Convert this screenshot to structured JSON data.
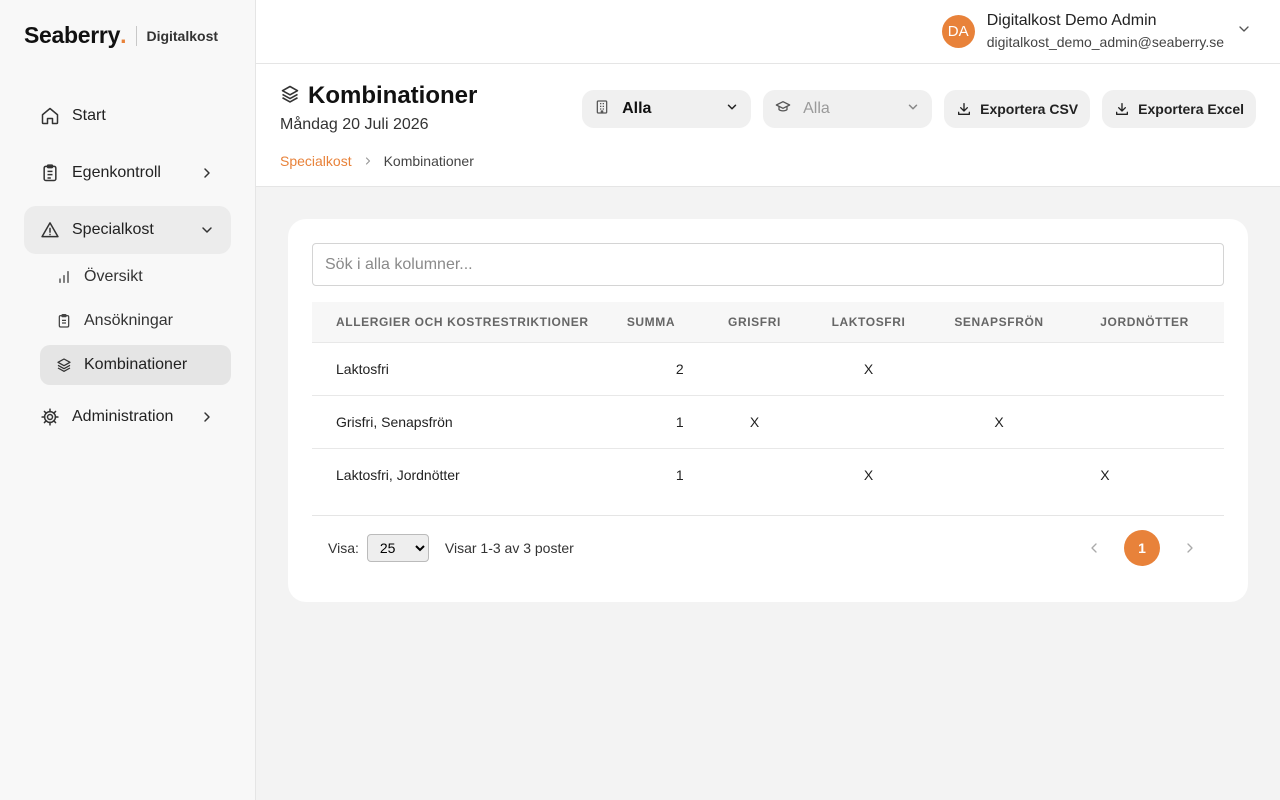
{
  "brand": {
    "name": "Seaberry",
    "dot": ".",
    "product": "Digitalkost"
  },
  "sidebar": {
    "items": [
      {
        "label": "Start",
        "icon": "home-icon"
      },
      {
        "label": "Egenkontroll",
        "icon": "clipboard-icon"
      },
      {
        "label": "Specialkost",
        "icon": "warning-icon",
        "open": true,
        "children": [
          {
            "label": "Översikt",
            "icon": "bar-chart-icon"
          },
          {
            "label": "Ansökningar",
            "icon": "clipboard-icon"
          },
          {
            "label": "Kombinationer",
            "icon": "layers-icon",
            "active": true
          }
        ]
      },
      {
        "label": "Administration",
        "icon": "gear-icon"
      }
    ]
  },
  "user": {
    "initials": "DA",
    "name": "Digitalkost Demo Admin",
    "email": "digitalkost_demo_admin@seaberry.se"
  },
  "page": {
    "title": "Kombinationer",
    "date": "Måndag 20 Juli 2026"
  },
  "breadcrumb": {
    "parent": "Specialkost",
    "current": "Kombinationer"
  },
  "filters": {
    "unit": "Alla",
    "group": "Alla"
  },
  "actions": {
    "export_csv": "Exportera CSV",
    "export_excel": "Exportera Excel"
  },
  "search": {
    "placeholder": "Sök i alla kolumner..."
  },
  "table": {
    "headers": [
      "ALLERGIER OCH KOSTRESTRIKTIONER",
      "SUMMA",
      "GRISFRI",
      "LAKTOSFRI",
      "SENAPSFRÖN",
      "JORDNÖTTER"
    ],
    "rows": [
      [
        "Laktosfri",
        "2",
        "",
        "X",
        "",
        ""
      ],
      [
        "Grisfri, Senapsfrön",
        "1",
        "X",
        "",
        "X",
        ""
      ],
      [
        "Laktosfri, Jordnötter",
        "1",
        "",
        "X",
        "",
        "X"
      ]
    ]
  },
  "pagination": {
    "show_label": "Visa:",
    "page_size": "25",
    "summary": "Visar 1-3 av 3 poster",
    "current_page": "1"
  },
  "colors": {
    "accent": "#e8823a"
  }
}
